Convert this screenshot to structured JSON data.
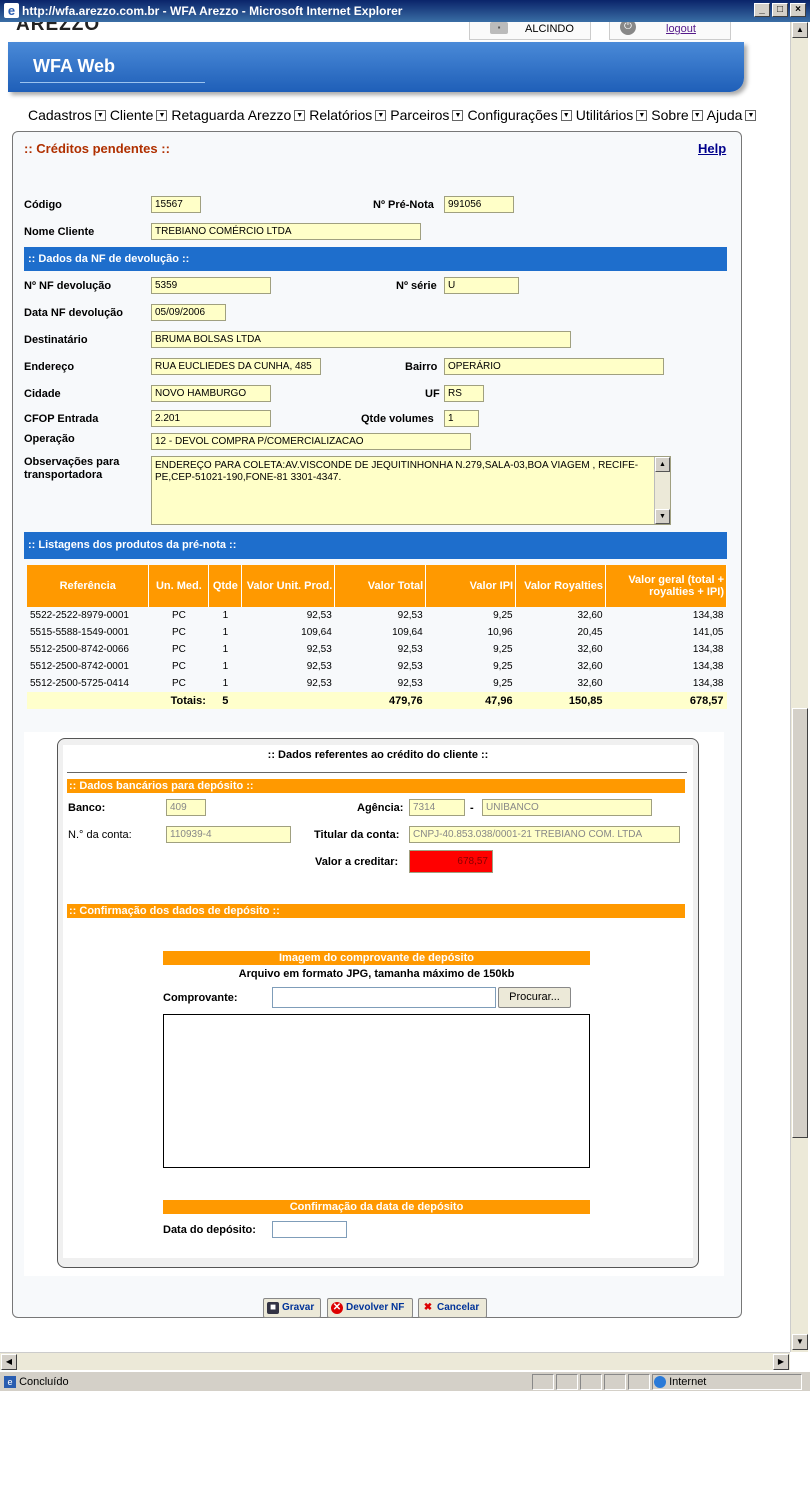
{
  "window": {
    "title": "http://wfa.arezzo.com.br - WFA Arezzo - Microsoft Internet Explorer",
    "status_text": "Concluído",
    "zone_text": "Internet"
  },
  "header": {
    "logo": "AREZZO",
    "user_name": "ALCINDO",
    "logout_label": "logout",
    "app_title": "WFA Web"
  },
  "menu": [
    {
      "label": "Cadastros"
    },
    {
      "label": "Cliente"
    },
    {
      "label": "Retaguarda Arezzo"
    },
    {
      "label": "Relatórios"
    },
    {
      "label": "Parceiros"
    },
    {
      "label": "Configurações"
    },
    {
      "label": "Utilitários"
    },
    {
      "label": "Sobre"
    },
    {
      "label": "Ajuda"
    }
  ],
  "page": {
    "title": ":: Créditos pendentes ::",
    "help_label": "Help"
  },
  "prenota": {
    "codigo_label": "Código",
    "codigo": "15567",
    "numero_label": "Nº Pré-Nota",
    "numero": "991056",
    "cliente_label": "Nome Cliente",
    "cliente": "TREBIANO COMÉRCIO LTDA"
  },
  "nf": {
    "section_title": ":: Dados da NF de devolução ::",
    "nf_label": "Nº NF devolução",
    "nf": "5359",
    "serie_label": "Nº série",
    "serie": "U",
    "data_label": "Data NF devolução",
    "data": "05/09/2006",
    "dest_label": "Destinatário",
    "dest": "BRUMA BOLSAS LTDA",
    "end_label": "Endereço",
    "end": "RUA EUCLIEDES DA CUNHA, 485",
    "bairro_label": "Bairro",
    "bairro": "OPERÁRIO",
    "cidade_label": "Cidade",
    "cidade": "NOVO HAMBURGO",
    "uf_label": "UF",
    "uf": "RS",
    "cfop_label": "CFOP Entrada",
    "cfop": "2.201",
    "volumes_label": "Qtde volumes",
    "volumes": "1",
    "operacao_label": "Operação",
    "operacao": "12 - DEVOL COMPRA P/COMERCIALIZACAO",
    "obs_label": "Observações para transportadora",
    "obs": "ENDEREÇO PARA COLETA:AV.VISCONDE DE JEQUITINHONHA N.279,SALA-03,BOA VIAGEM , RECIFE-PE,CEP-51021-190,FONE-81 3301-4347."
  },
  "products": {
    "section_title": ":: Listagens dos produtos da pré-nota ::",
    "headers": [
      "Referência",
      "Un. Med.",
      "Qtde",
      "Valor Unit. Prod.",
      "Valor Total",
      "Valor IPI",
      "Valor Royalties",
      "Valor geral (total + royalties + IPI)"
    ],
    "rows": [
      [
        "5522-2522-8979-0001",
        "PC",
        "1",
        "92,53",
        "92,53",
        "9,25",
        "32,60",
        "134,38"
      ],
      [
        "5515-5588-1549-0001",
        "PC",
        "1",
        "109,64",
        "109,64",
        "10,96",
        "20,45",
        "141,05"
      ],
      [
        "5512-2500-8742-0066",
        "PC",
        "1",
        "92,53",
        "92,53",
        "9,25",
        "32,60",
        "134,38"
      ],
      [
        "5512-2500-8742-0001",
        "PC",
        "1",
        "92,53",
        "92,53",
        "9,25",
        "32,60",
        "134,38"
      ],
      [
        "5512-2500-5725-0414",
        "PC",
        "1",
        "92,53",
        "92,53",
        "9,25",
        "32,60",
        "134,38"
      ]
    ],
    "totals_label": "Totais:",
    "totals": {
      "qtde": "5",
      "total": "479,76",
      "ipi": "47,96",
      "royalties": "150,85",
      "geral": "678,57"
    }
  },
  "credit": {
    "title": ":: Dados referentes ao crédito do cliente ::",
    "bank_section": ":: Dados bancários para depósito ::",
    "banco_label": "Banco:",
    "banco": "409",
    "agencia_label": "Agência:",
    "agencia": "7314",
    "dash": "-",
    "banco_nome": "UNIBANCO",
    "conta_label": "N.° da conta:",
    "conta": "110939-4",
    "titular_label": "Titular da conta:",
    "titular": "CNPJ-40.853.038/0001-21 TREBIANO COM. LTDA",
    "valor_label": "Valor a creditar:",
    "valor": "678,57",
    "confirm_section": ":: Confirmação dos dados de depósito ::",
    "img_header": "Imagem do comprovante de depósito",
    "img_hint": "Arquivo em formato JPG, tamanha máximo de 150kb",
    "comprovante_label": "Comprovante:",
    "procurar_label": "Procurar...",
    "date_header": "Confirmação da data de depósito",
    "date_label": "Data do depósito:"
  },
  "actions": {
    "gravar": "Gravar",
    "devolver": "Devolver NF",
    "cancelar": "Cancelar"
  }
}
